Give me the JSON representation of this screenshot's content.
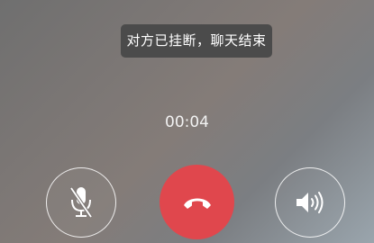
{
  "call": {
    "toast_message": "对方已挂断，聊天结束",
    "duration": "00:04"
  },
  "controls": {
    "mute": {
      "icon": "mic-muted-icon",
      "state": "muted"
    },
    "hangup": {
      "icon": "phone-hangup-icon",
      "color": "#e0474d"
    },
    "speaker": {
      "icon": "speaker-icon",
      "state": "off"
    }
  }
}
